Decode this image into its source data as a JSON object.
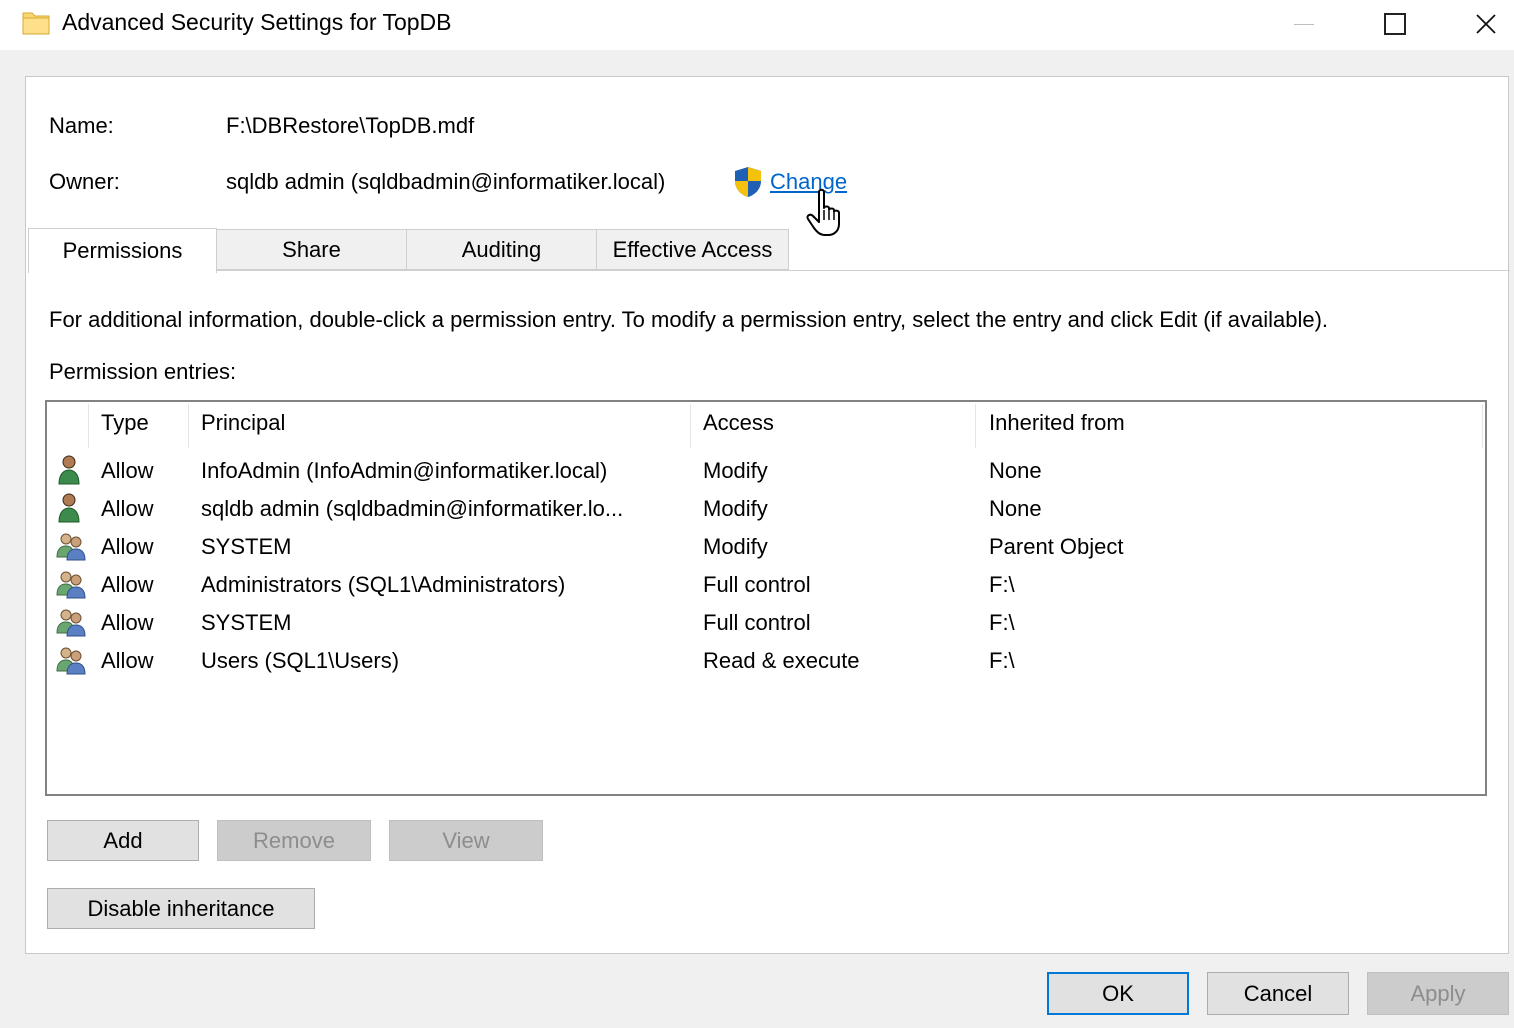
{
  "window": {
    "title": "Advanced Security Settings for TopDB",
    "icon": "folder-icon",
    "controls": [
      "minimize-icon",
      "maximize-icon",
      "close-icon"
    ]
  },
  "info": {
    "name_label": "Name:",
    "name_value": "F:\\DBRestore\\TopDB.mdf",
    "owner_label": "Owner:",
    "owner_value": "sqldb admin (sqldbadmin@informatiker.local)",
    "change_link": "Change",
    "shield_icon": "uac-shield-icon"
  },
  "tabs": [
    {
      "label": "Permissions",
      "active": true
    },
    {
      "label": "Share",
      "active": false
    },
    {
      "label": "Auditing",
      "active": false
    },
    {
      "label": "Effective Access",
      "active": false
    }
  ],
  "permissions": {
    "instructions": "For additional information, double-click a permission entry. To modify a permission entry, select the entry and click Edit (if available).",
    "entries_label": "Permission entries:",
    "columns": [
      "Type",
      "Principal",
      "Access",
      "Inherited from"
    ],
    "rows": [
      {
        "icon": "user-icon",
        "type": "Allow",
        "principal": "InfoAdmin (InfoAdmin@informatiker.local)",
        "access": "Modify",
        "inherited": "None"
      },
      {
        "icon": "user-icon",
        "type": "Allow",
        "principal": "sqldb admin (sqldbadmin@informatiker.lo...",
        "access": "Modify",
        "inherited": "None"
      },
      {
        "icon": "group-icon",
        "type": "Allow",
        "principal": "SYSTEM",
        "access": "Modify",
        "inherited": "Parent Object"
      },
      {
        "icon": "group-icon",
        "type": "Allow",
        "principal": "Administrators (SQL1\\Administrators)",
        "access": "Full control",
        "inherited": "F:\\"
      },
      {
        "icon": "group-icon",
        "type": "Allow",
        "principal": "SYSTEM",
        "access": "Full control",
        "inherited": "F:\\"
      },
      {
        "icon": "group-icon",
        "type": "Allow",
        "principal": "Users (SQL1\\Users)",
        "access": "Read & execute",
        "inherited": "F:\\"
      }
    ]
  },
  "buttons": {
    "add": "Add",
    "remove": "Remove",
    "view": "View",
    "disable_inheritance": "Disable inheritance",
    "ok": "OK",
    "cancel": "Cancel",
    "apply": "Apply"
  },
  "colors": {
    "link": "#0066cc",
    "accent": "#0078d7",
    "disabled_text": "#8d8d8d"
  }
}
